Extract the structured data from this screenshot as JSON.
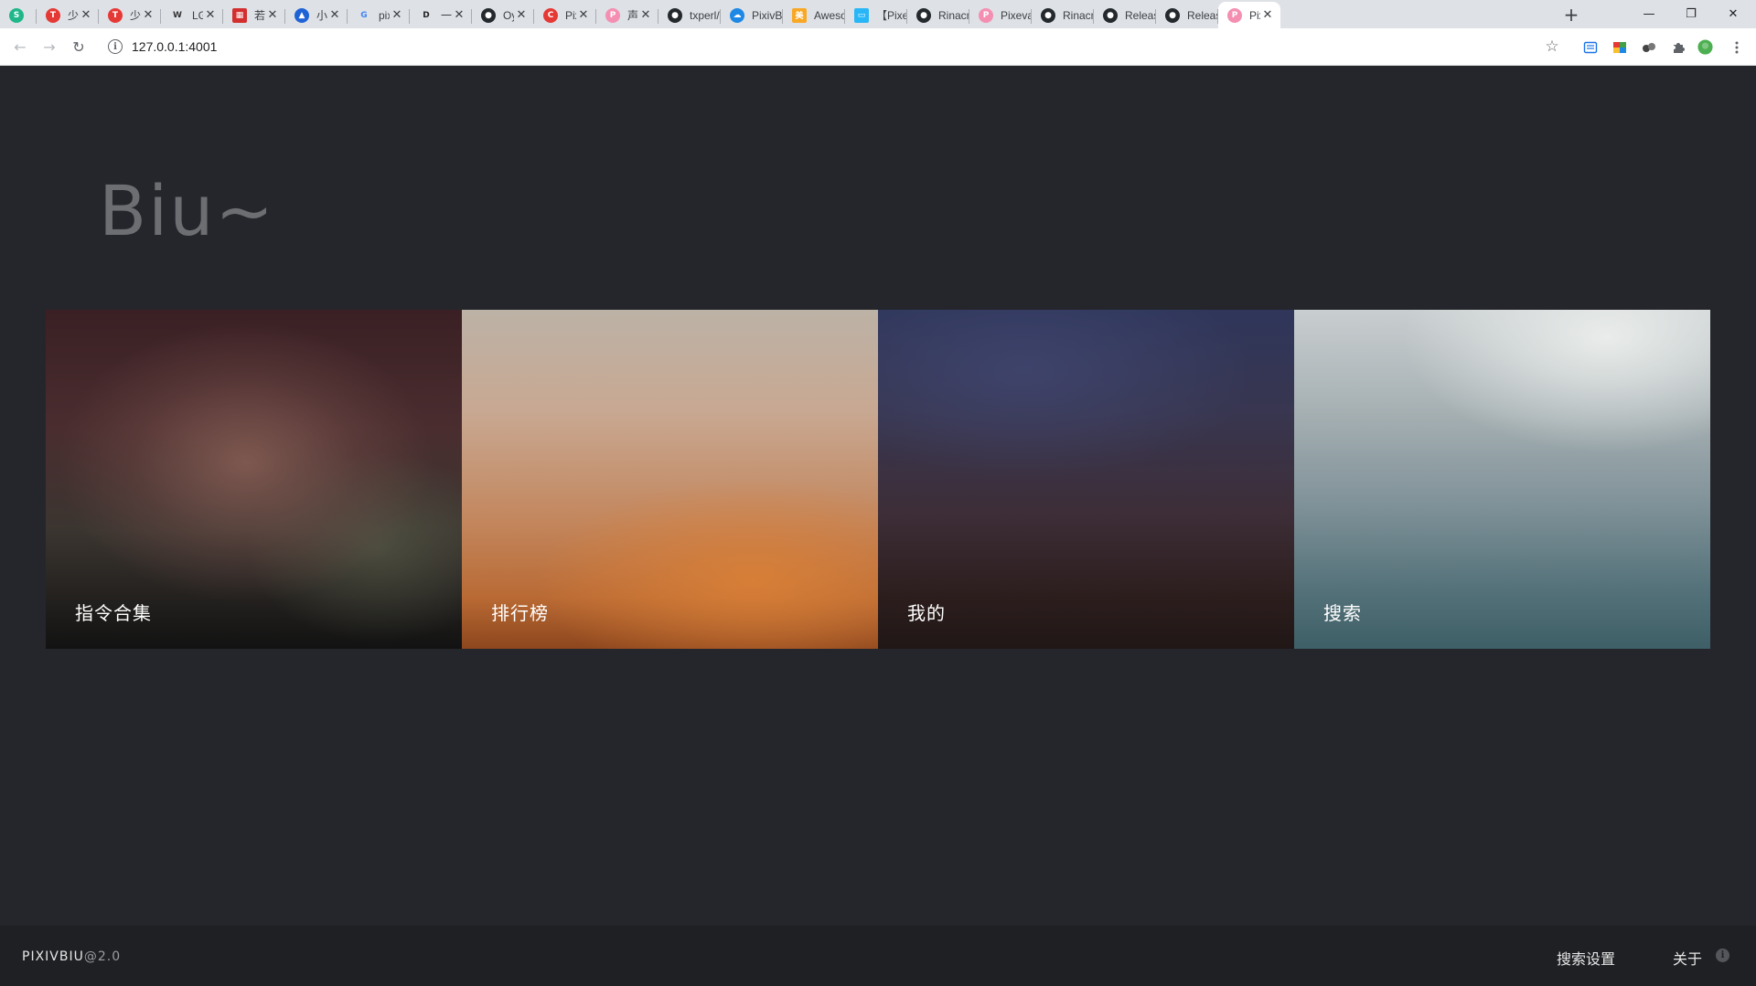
{
  "browser": {
    "tabs": [
      {
        "title": "",
        "icon": "s-circle-icon",
        "color": "#1fb78a"
      },
      {
        "title": "少数",
        "icon": "red-t-icon",
        "color": "#e53935"
      },
      {
        "title": "少数",
        "icon": "red-t-icon",
        "color": "#e53935"
      },
      {
        "title": "LGI",
        "icon": "wikipedia-icon",
        "color": "#333333"
      },
      {
        "title": "若叶",
        "icon": "red-grid-icon",
        "color": "#d32f2f"
      },
      {
        "title": "小众",
        "icon": "blue-drop-icon",
        "color": "#1e63d6"
      },
      {
        "title": "pixi",
        "icon": "google-icon",
        "color": "#4285f4"
      },
      {
        "title": "一个",
        "icon": "d-arrow-icon",
        "color": "#222222"
      },
      {
        "title": "Oy",
        "icon": "github-icon",
        "color": "#24292e"
      },
      {
        "title": "Pixi",
        "icon": "c-circle-icon",
        "color": "#e53935"
      },
      {
        "title": "声音",
        "icon": "pink-p-icon",
        "color": "#f48fb1"
      },
      {
        "title": "txperl/P",
        "icon": "github-icon",
        "color": "#24292e"
      },
      {
        "title": "PixivBiu",
        "icon": "cloud-icon",
        "color": "#1e88e5"
      },
      {
        "title": "Awesom",
        "icon": "yellow-square-icon",
        "color": "#f9a825"
      },
      {
        "title": "【Pixev",
        "icon": "tv-icon",
        "color": "#29b6f6"
      },
      {
        "title": "Rinacm",
        "icon": "github-icon",
        "color": "#24292e"
      },
      {
        "title": "Pixeval",
        "icon": "pink-p-icon",
        "color": "#f48fb1"
      },
      {
        "title": "Rinacm",
        "icon": "github-icon",
        "color": "#24292e"
      },
      {
        "title": "Release",
        "icon": "github-icon",
        "color": "#24292e"
      },
      {
        "title": "Release",
        "icon": "github-icon",
        "color": "#24292e"
      },
      {
        "title": "Pixi",
        "icon": "pink-p-icon",
        "color": "#f48fb1",
        "active": true
      }
    ],
    "new_tab_label": "+",
    "window_controls": {
      "minimize": "—",
      "restore": "❐",
      "close": "✕"
    },
    "url": "127.0.0.1:4001"
  },
  "page": {
    "title": "Biu~",
    "cards": [
      {
        "label": "指令合集"
      },
      {
        "label": "排行榜"
      },
      {
        "label": "我的"
      },
      {
        "label": "搜索"
      }
    ]
  },
  "footer": {
    "brand": "PIXIVBIU",
    "version": "@2.0",
    "links": {
      "search_settings": "搜索设置",
      "about": "关于"
    },
    "info_glyph": "i"
  }
}
